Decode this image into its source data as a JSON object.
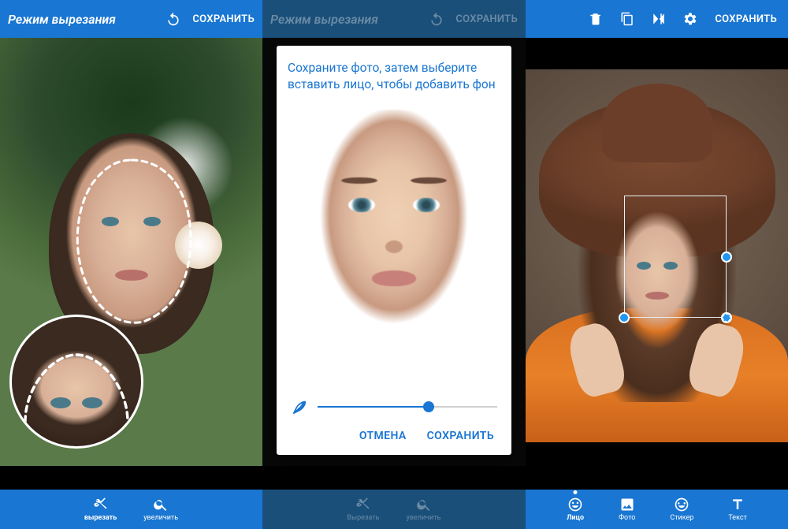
{
  "screen1": {
    "title": "Режим вырезания",
    "save": "СОХРАНИТЬ",
    "bottom": {
      "cut": "вырезать",
      "zoom": "увеличить"
    }
  },
  "screen2": {
    "title": "Режим вырезания",
    "save": "СОХРАНИТЬ",
    "dialog": {
      "message": "Сохраните фото, затем выберите вставить лицо, чтобы добавить фон",
      "cancel": "ОТМЕНА",
      "confirm": "СОХРАНИТЬ",
      "slider_pct": 62
    },
    "bottom": {
      "cut": "Вырезать",
      "zoom": "увеличить"
    }
  },
  "screen3": {
    "save": "СОХРАНИТЬ",
    "bottom": {
      "face": "Лицо",
      "photo": "Фото",
      "sticker": "Стикер",
      "text": "Текст"
    }
  }
}
